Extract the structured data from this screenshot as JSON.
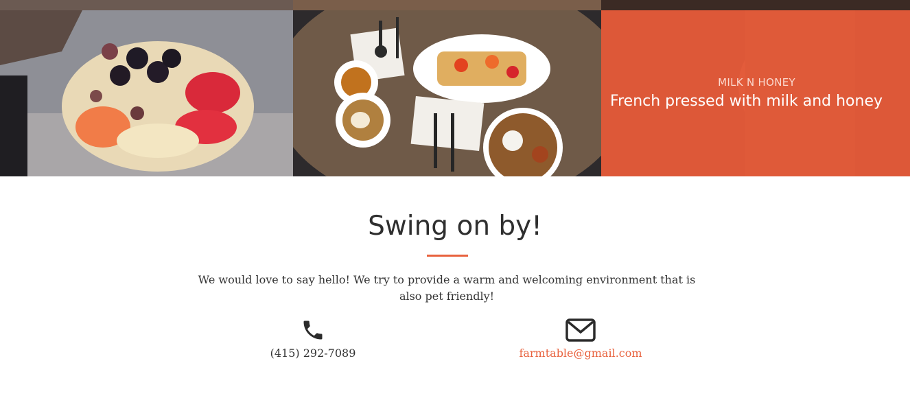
{
  "gallery": {
    "feature": {
      "kicker": "MILK N HONEY",
      "title": "French pressed with milk and honey"
    },
    "accent_color": "#ea5c3a"
  },
  "contact": {
    "heading": "Swing on by!",
    "lead": "We would love to say hello! We try to provide a warm and welcoming environment that is also pet friendly!",
    "phone": {
      "icon": "phone-icon",
      "text": "(415) 292-7089"
    },
    "email": {
      "icon": "envelope-icon",
      "text": "farmtable@gmail.com"
    },
    "link_color": "#e8623e"
  }
}
